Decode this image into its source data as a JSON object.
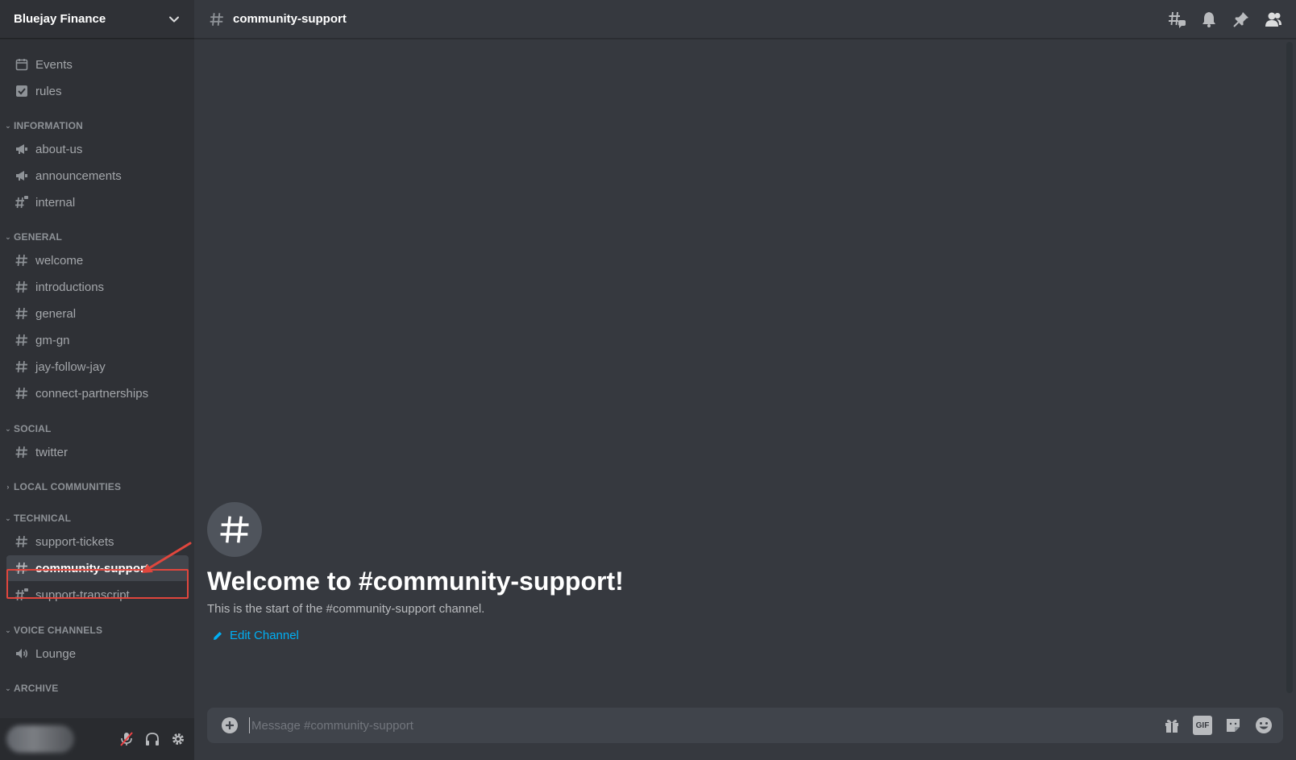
{
  "server": {
    "name": "Bluejay Finance"
  },
  "sidebar": {
    "top_items": [
      {
        "label": "Events",
        "icon": "calendar-icon"
      },
      {
        "label": "rules",
        "icon": "checkbox-icon"
      }
    ],
    "categories": [
      {
        "name": "INFORMATION",
        "channels": [
          "about-us",
          "announcements",
          "internal"
        ]
      },
      {
        "name": "GENERAL",
        "channels": [
          "welcome",
          "introductions",
          "general",
          "gm-gn",
          "jay-follow-jay",
          "connect-partnerships"
        ]
      },
      {
        "name": "SOCIAL",
        "channels": [
          "twitter"
        ]
      },
      {
        "name": "LOCAL COMMUNITIES",
        "channels": []
      },
      {
        "name": "TECHNICAL",
        "channels": [
          "support-tickets",
          "community-support",
          "support-transcript"
        ]
      },
      {
        "name": "VOICE CHANNELS",
        "channels": [
          "Lounge"
        ]
      },
      {
        "name": "ARCHIVE",
        "channels": []
      }
    ],
    "active_channel": "community-support"
  },
  "header": {
    "channel": "community-support"
  },
  "welcome": {
    "title": "Welcome to #community-support!",
    "subtitle": "This is the start of the #community-support channel.",
    "edit_label": "Edit Channel"
  },
  "composer": {
    "placeholder": "Message #community-support",
    "gif_label": "GIF"
  },
  "colors": {
    "accent_link": "#00aff4",
    "highlight": "#e0463d",
    "sidebar_bg": "#2f3136",
    "main_bg": "#36393f"
  }
}
